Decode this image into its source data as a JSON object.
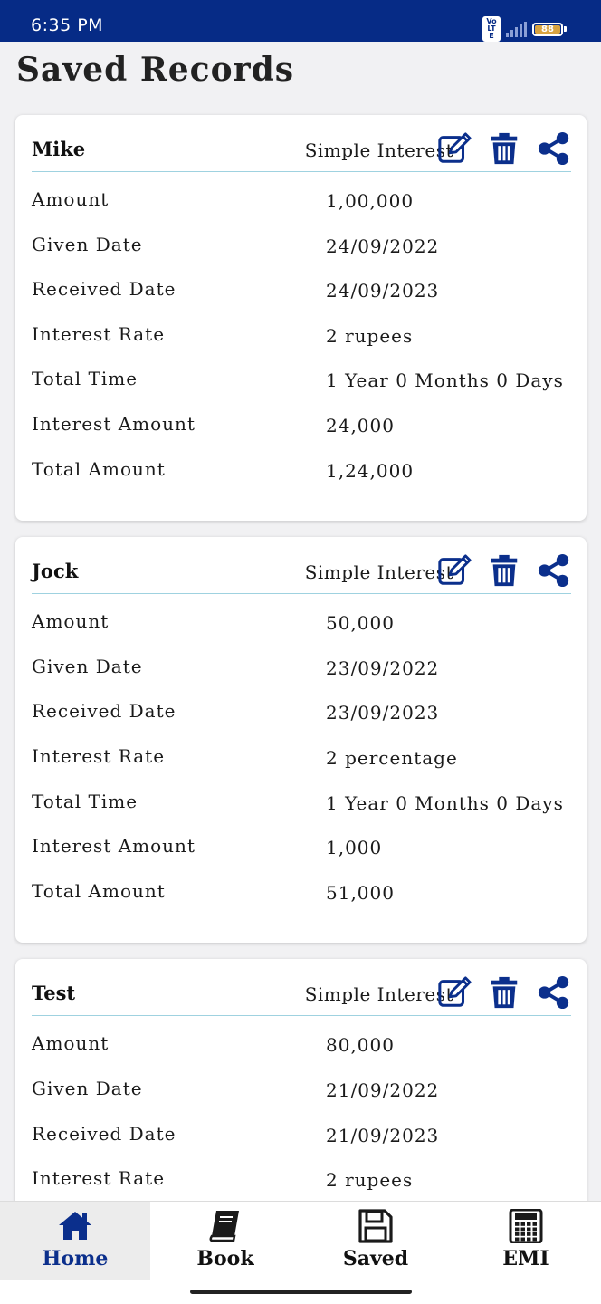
{
  "status_bar": {
    "time": "6:35 PM",
    "network_badge": "Vo LTE",
    "battery_level": "88"
  },
  "page_title": "Saved Records",
  "records": [
    {
      "name": "Mike",
      "type": "Simple Interest",
      "rows": [
        {
          "label": "Amount",
          "value": "1,00,000"
        },
        {
          "label": "Given Date",
          "value": "24/09/2022"
        },
        {
          "label": "Received Date",
          "value": "24/09/2023"
        },
        {
          "label": "Interest Rate",
          "value": "2 rupees"
        },
        {
          "label": "Total Time",
          "value": "1 Year 0 Months 0 Days"
        },
        {
          "label": "Interest Amount",
          "value": "24,000"
        },
        {
          "label": "Total Amount",
          "value": "1,24,000"
        }
      ]
    },
    {
      "name": "Jock",
      "type": "Simple Interest",
      "rows": [
        {
          "label": "Amount",
          "value": "50,000"
        },
        {
          "label": "Given Date",
          "value": "23/09/2022"
        },
        {
          "label": "Received Date",
          "value": "23/09/2023"
        },
        {
          "label": "Interest Rate",
          "value": "2 percentage"
        },
        {
          "label": "Total Time",
          "value": "1 Year 0 Months 0 Days"
        },
        {
          "label": "Interest Amount",
          "value": "1,000"
        },
        {
          "label": "Total Amount",
          "value": "51,000"
        }
      ]
    },
    {
      "name": "Test",
      "type": "Simple Interest",
      "rows": [
        {
          "label": "Amount",
          "value": "80,000"
        },
        {
          "label": "Given Date",
          "value": "21/09/2022"
        },
        {
          "label": "Received Date",
          "value": "21/09/2023"
        },
        {
          "label": "Interest Rate",
          "value": "2 rupees"
        }
      ]
    }
  ],
  "bottom_nav": [
    {
      "label": "Home",
      "icon": "home-icon",
      "active": true
    },
    {
      "label": "Book",
      "icon": "book-icon",
      "active": false
    },
    {
      "label": "Saved",
      "icon": "save-icon",
      "active": false
    },
    {
      "label": "EMI",
      "icon": "calculator-icon",
      "active": false
    }
  ],
  "colors": {
    "status_bar": "#062b86",
    "accent_icon": "#0b2f8c",
    "divider": "#9fd2e0",
    "battery": "#d9a441"
  }
}
